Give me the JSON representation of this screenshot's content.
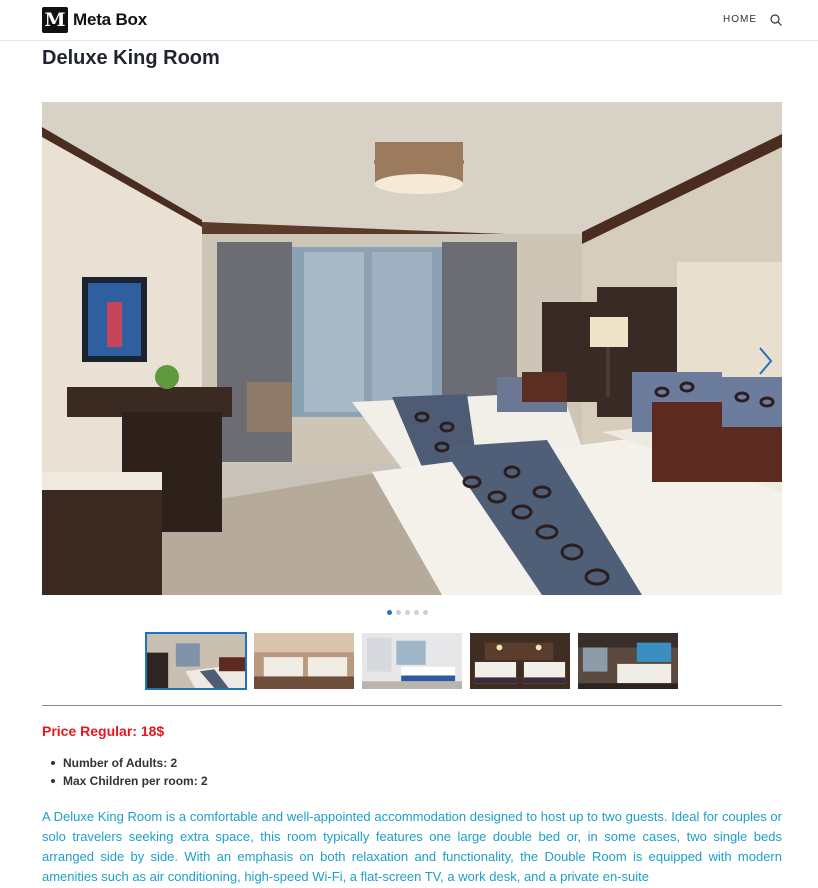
{
  "header": {
    "logo_letter": "M",
    "logo_text": "Meta Box",
    "nav_home": "HOME",
    "search_icon": "search-icon"
  },
  "room": {
    "title": "Deluxe King Room",
    "price_label": "Price Regular: 18$",
    "features": [
      "Number of Adults: 2",
      "Max Children per room: 2"
    ],
    "description": "A Deluxe King Room is a comfortable and well-appointed accommodation designed to host up to two guests. Ideal for couples or solo travelers seeking extra space, this room typically features one large double bed or, in some cases, two single beds arranged side by side. With an emphasis on both relaxation and functionality, the Double Room is equipped with modern amenities such as air conditioning, high-speed Wi-Fi, a flat-screen TV, a work desk, and a private en-suite"
  },
  "slider": {
    "prev_icon": "chevron-left-icon",
    "next_icon": "chevron-right-icon",
    "slide_count": 5,
    "active_slide": 1,
    "thumbnail_count": 5
  },
  "colors": {
    "accent": "#1e73be",
    "price": "#e0191f",
    "description": "#1c9fc9"
  }
}
